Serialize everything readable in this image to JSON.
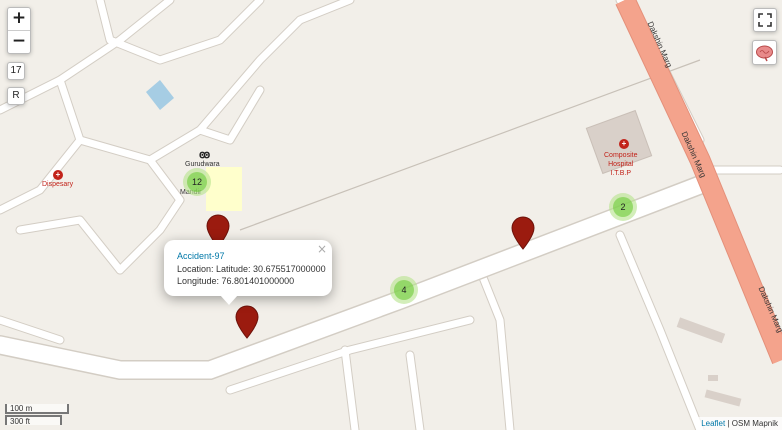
{
  "controls": {
    "zoom_in": "+",
    "zoom_out": "−",
    "zoom_level": "17",
    "reset": "R",
    "fullscreen_icon": "fullscreen-icon",
    "layers_icon": "brain-layer-icon"
  },
  "map_labels": {
    "road_1": "Dakshin Marg",
    "road_2": "Dakshin Marg",
    "road_3": "Dakshin Marg",
    "hospital": "Composite\nHospital\nI.T.B.P",
    "hospital_line1": "Composite",
    "hospital_line2": "Hospital",
    "hospital_line3": "I.T.B.P",
    "dispensary": "Dispesary",
    "gurudwara": "Gurudwara",
    "mandir": "Mandir"
  },
  "clusters": [
    {
      "count": "12"
    },
    {
      "count": "2"
    },
    {
      "count": "4"
    }
  ],
  "popup": {
    "title": "Accident-97",
    "location_line": "Location: Latitude: 30.675517000000",
    "longitude_line": "Longitude: 76.801401000000",
    "close": "×"
  },
  "scale": {
    "metric": "100 m",
    "imperial": "300 ft"
  },
  "attribution": {
    "leaflet": "Leaflet",
    "separator": " | ",
    "tiles": "OSM Mapnik"
  },
  "colors": {
    "land": "#f2efe9",
    "road": "#ffffff",
    "primary_road": "#f4a38c",
    "marker": "#9b1b0f",
    "cluster": "#b5e28c",
    "cluster_inner": "#6ecc39",
    "water": "#a6cde4",
    "landuse": "#ffffcc"
  }
}
